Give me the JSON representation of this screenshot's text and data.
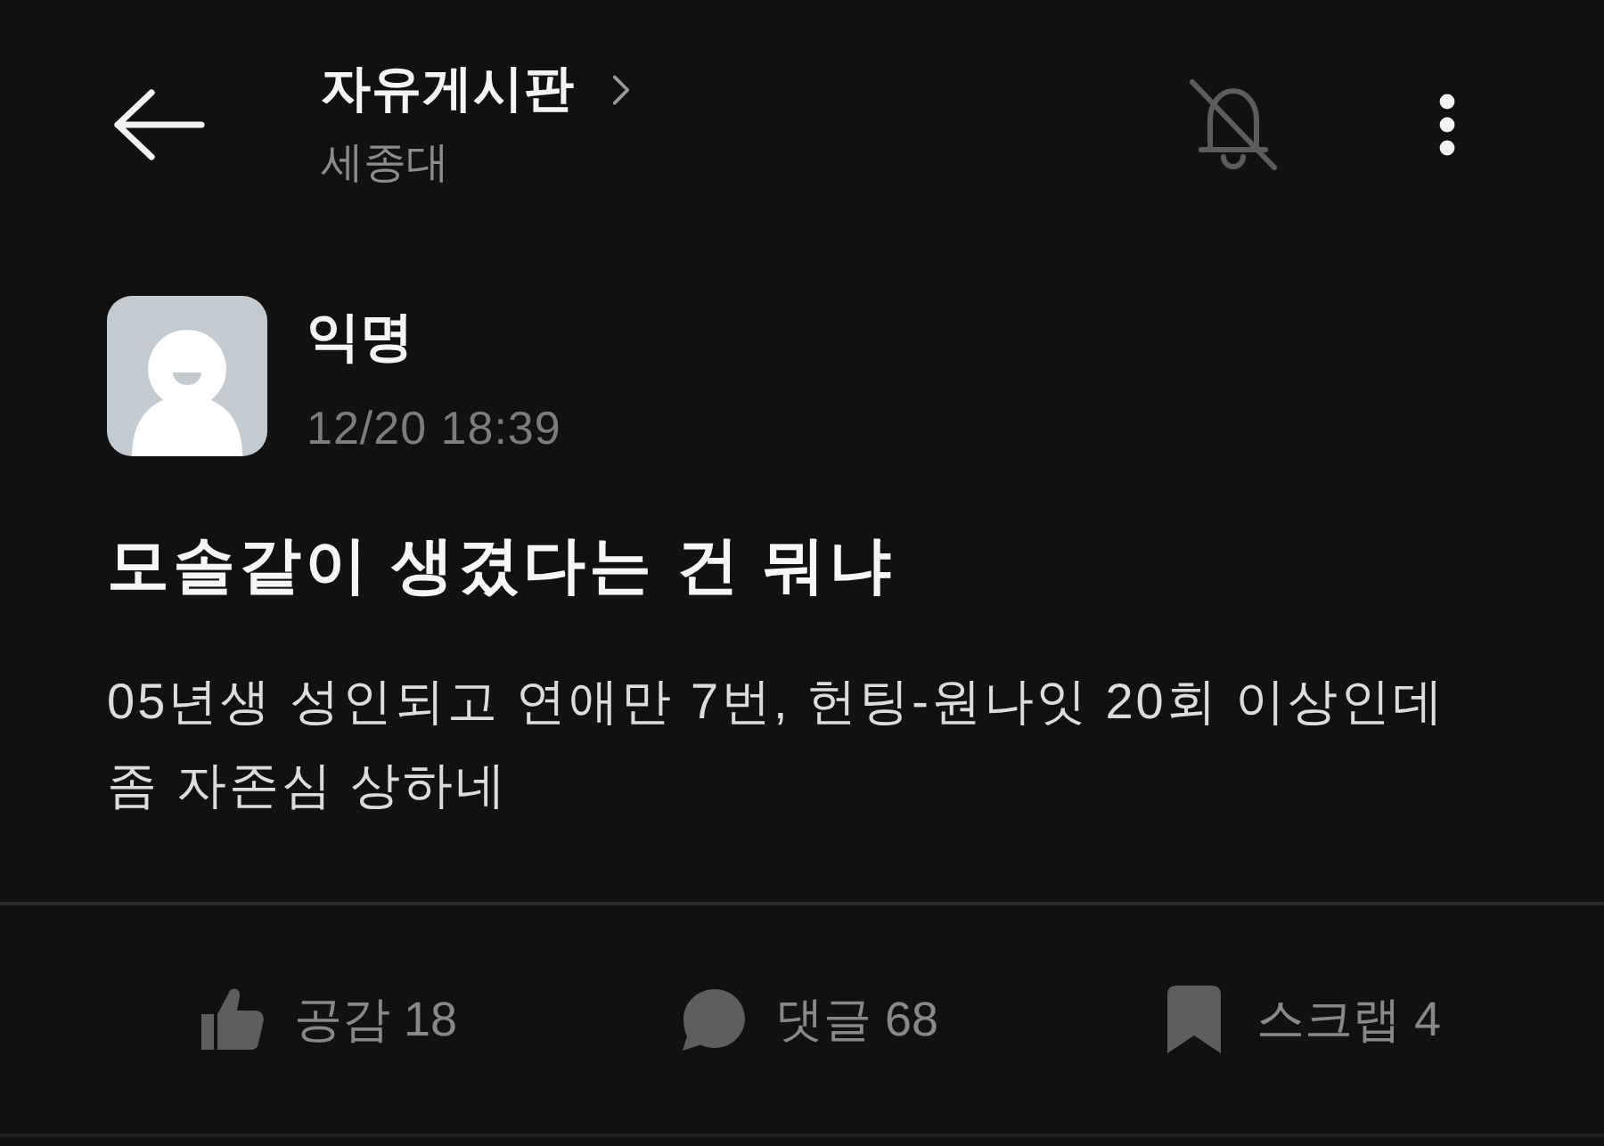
{
  "header": {
    "title": "자유게시판",
    "subtitle": "세종대",
    "notifications_on": false
  },
  "post": {
    "author": "익명",
    "time": "12/20 18:39",
    "title": "모솔같이 생겼다는 건 뭐냐",
    "body": "05년생 성인되고 연애만 7번, 헌팅-원나잇 20회 이상인데 좀 자존심 상하네"
  },
  "actions": [
    {
      "kind": "like",
      "label": "공감 18"
    },
    {
      "kind": "comment",
      "label": "댓글 68"
    },
    {
      "kind": "scrap",
      "label": "스크랩 4"
    }
  ]
}
